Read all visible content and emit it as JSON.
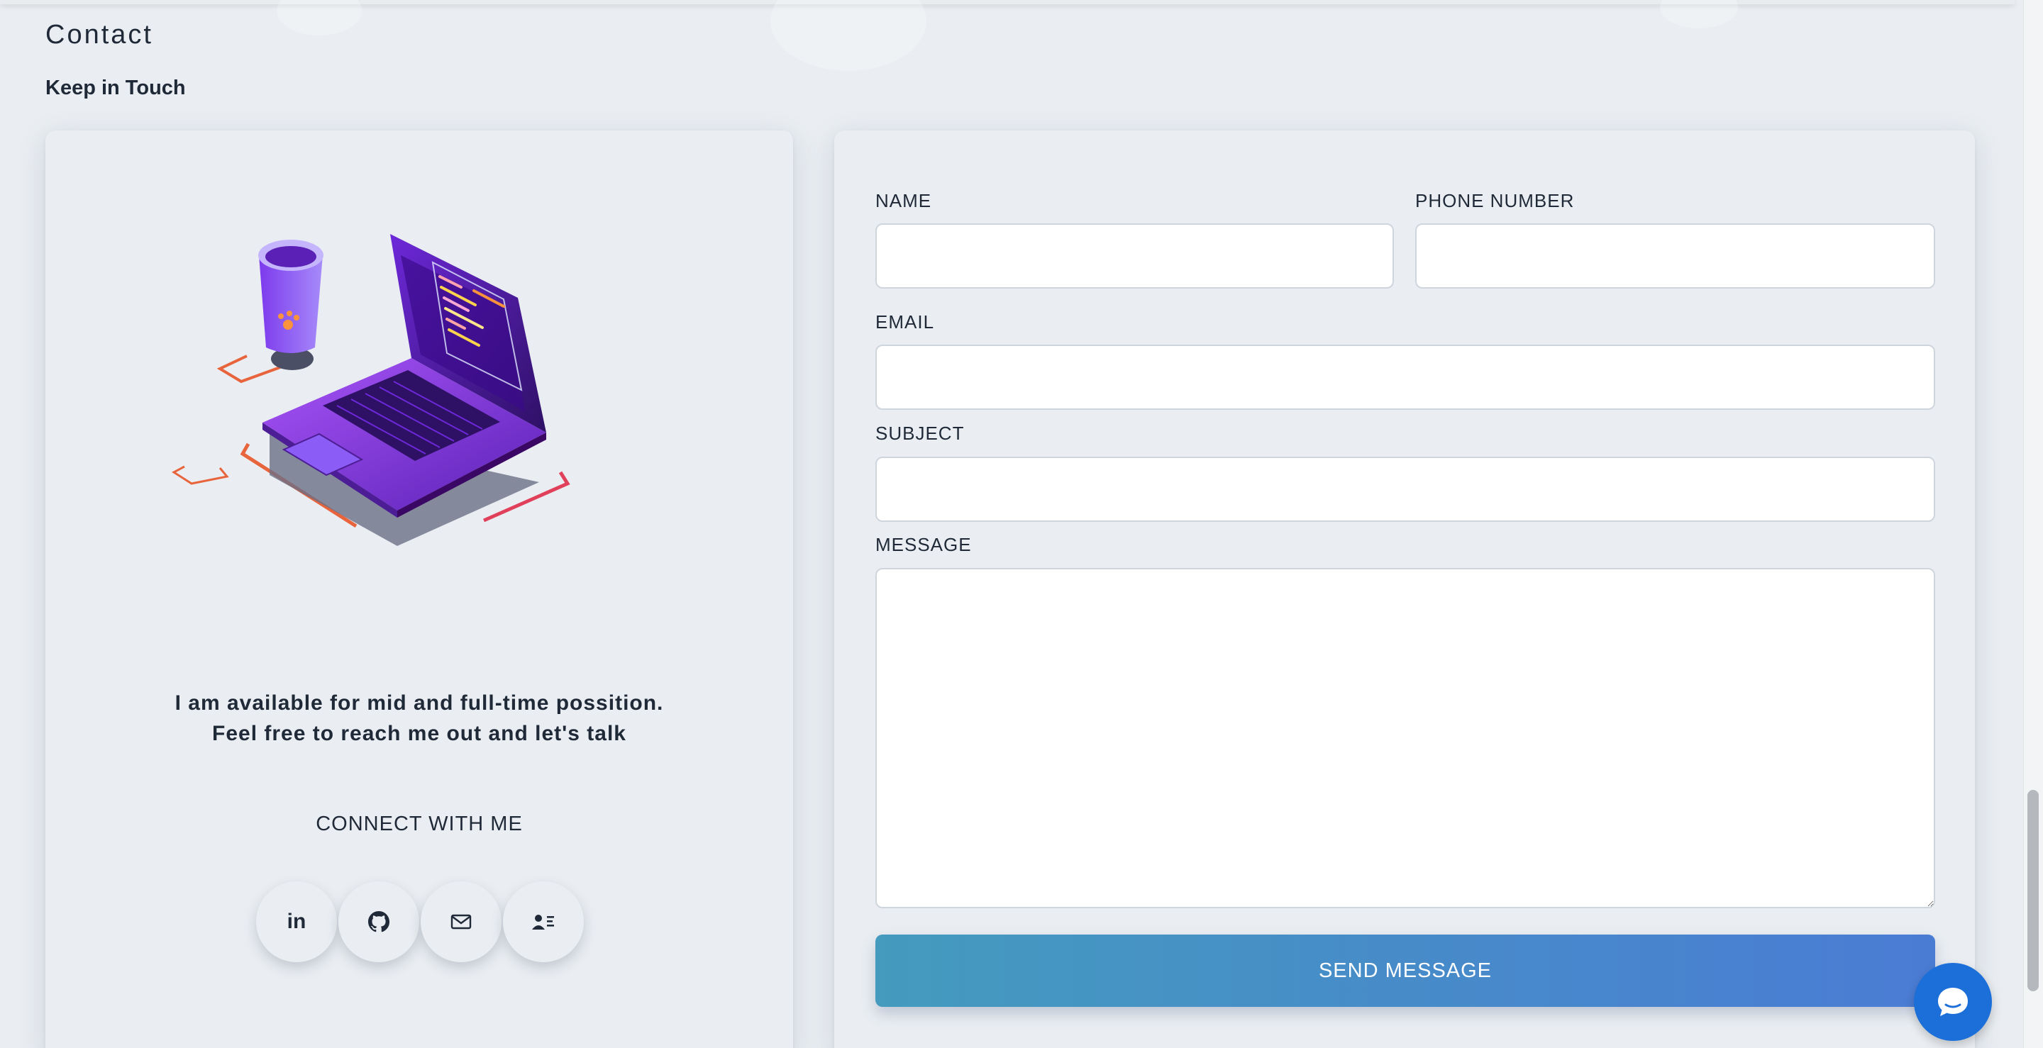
{
  "section": {
    "title": "Contact",
    "subtitle": "Keep in Touch"
  },
  "left_card": {
    "availability_line1": "I am available for mid and full-time possition.",
    "availability_line2": "Feel free to reach me out and let's talk",
    "connect_heading": "CONNECT WITH ME",
    "social_icons": [
      "linkedin-icon",
      "github-icon",
      "mail-icon",
      "contact-card-icon"
    ],
    "linkedin_glyph": "in"
  },
  "form": {
    "name_label": "NAME",
    "phone_label": "PHONE NUMBER",
    "email_label": "EMAIL",
    "subject_label": "SUBJECT",
    "message_label": "MESSAGE",
    "name_value": "",
    "phone_value": "",
    "email_value": "",
    "subject_value": "",
    "message_value": "",
    "submit_label": "SEND MESSAGE"
  },
  "colors": {
    "background": "#eaeef2",
    "button_gradient_start": "#449bbe",
    "button_gradient_end": "#4a7cd4",
    "chat_button": "#1c6fd8"
  },
  "chat_widget": {
    "icon": "chat-bubble-icon"
  }
}
